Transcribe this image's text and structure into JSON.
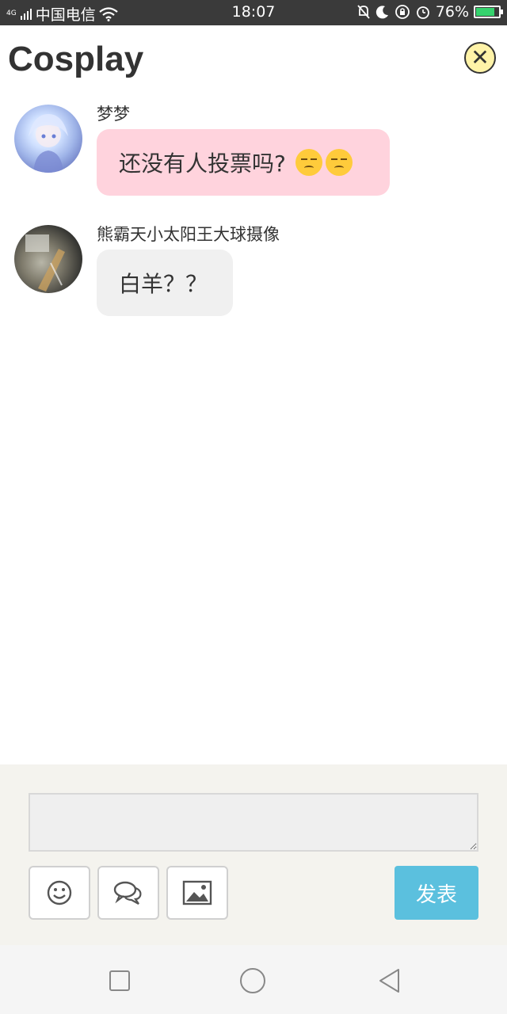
{
  "status_bar": {
    "network_tag": "4G",
    "carrier": "中国电信",
    "time": "18:07",
    "battery": "76%",
    "battery_level": 0.76
  },
  "header": {
    "title": "Cosplay"
  },
  "messages": [
    {
      "sender": "梦梦",
      "text": "还没有人投票吗?",
      "emojis": [
        "disappointed-face",
        "disappointed-face"
      ],
      "bubble_color": "#ffd3dd"
    },
    {
      "sender": "熊霸天小太阳王大球摄像",
      "text": "白羊？？",
      "bubble_color": "#f0f0f0"
    }
  ],
  "composer": {
    "input_value": "",
    "send_label": "发表",
    "send_color": "#5bc0de"
  },
  "colors": {
    "close_button": "#fff3a8",
    "composer_bg": "#f4f3ee"
  }
}
